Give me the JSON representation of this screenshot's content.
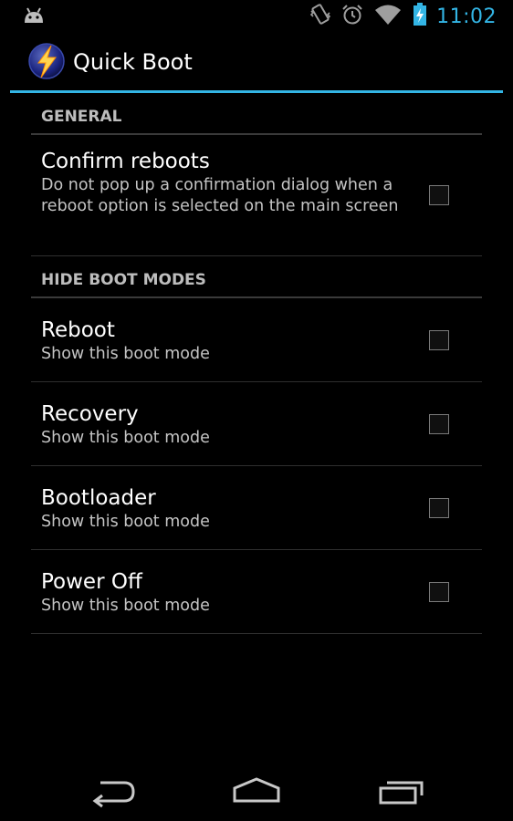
{
  "status_bar": {
    "time": "11:02",
    "icons": [
      "android-debug-icon",
      "vibrate-icon",
      "alarm-icon",
      "wifi-icon",
      "battery-charging-icon"
    ],
    "accent": "#33b5e5"
  },
  "action_bar": {
    "title": "Quick Boot",
    "icon": "lightning-bolt-icon",
    "accent": "#33b5e5"
  },
  "preferences": {
    "general": {
      "category": "GENERAL",
      "items": [
        {
          "title": "Confirm reboots",
          "summary": "Do not pop up a confirmation dialog when a reboot option is selected on the main screen",
          "checked": false
        }
      ]
    },
    "hide_boot_modes": {
      "category": "HIDE BOOT MODES",
      "items": [
        {
          "title": "Reboot",
          "summary": "Show this boot mode",
          "checked": false
        },
        {
          "title": "Recovery",
          "summary": "Show this boot mode",
          "checked": false
        },
        {
          "title": "Bootloader",
          "summary": "Show this boot mode",
          "checked": false
        },
        {
          "title": "Power Off",
          "summary": "Show this boot mode",
          "checked": false
        }
      ]
    }
  },
  "nav_bar": {
    "buttons": [
      "back-icon",
      "home-icon",
      "recent-apps-icon"
    ]
  }
}
